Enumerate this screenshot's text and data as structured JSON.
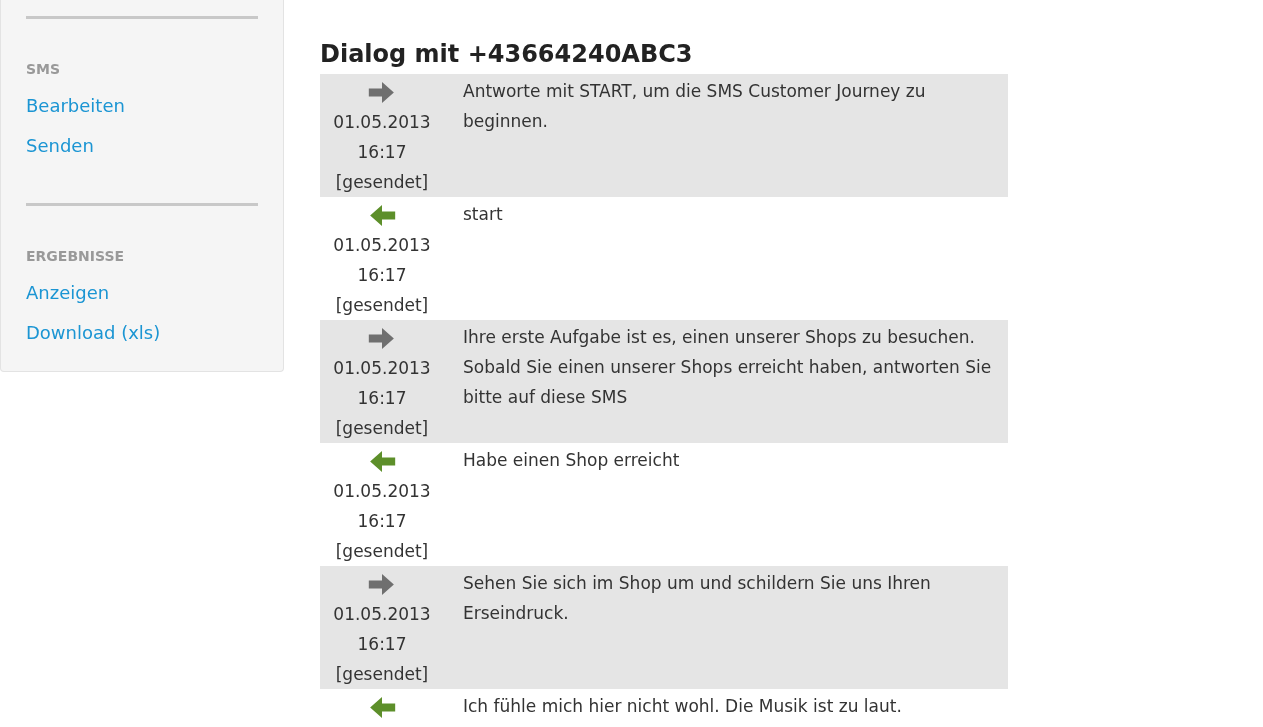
{
  "sidebar": {
    "sections": [
      {
        "header": "SMS",
        "links": [
          "Bearbeiten",
          "Senden"
        ]
      },
      {
        "header": "ERGEBNISSE",
        "links": [
          "Anzeigen",
          "Download (xls)"
        ]
      }
    ]
  },
  "dialog": {
    "title": "Dialog mit +43664240ABC3",
    "messages": [
      {
        "kind": "outgoing",
        "date": "01.05.2013",
        "time": "16:17",
        "status": "[gesendet]",
        "text": "Antworte mit START, um die SMS Customer Journey zu beginnen."
      },
      {
        "kind": "incoming",
        "date": "01.05.2013",
        "time": "16:17",
        "status": "[gesendet]",
        "text": "start"
      },
      {
        "kind": "outgoing",
        "date": "01.05.2013",
        "time": "16:17",
        "status": "[gesendet]",
        "text": "Ihre erste Aufgabe ist es, einen unserer Shops zu besuchen. Sobald Sie einen unserer Shops erreicht haben, antworten Sie bitte auf diese SMS"
      },
      {
        "kind": "incoming",
        "date": "01.05.2013",
        "time": "16:17",
        "status": "[gesendet]",
        "text": "Habe einen Shop erreicht"
      },
      {
        "kind": "outgoing",
        "date": "01.05.2013",
        "time": "16:17",
        "status": "[gesendet]",
        "text": "Sehen Sie sich im Shop um und schildern Sie uns Ihren Erseindruck."
      },
      {
        "kind": "incoming",
        "text": "Ich fühle mich hier nicht wohl. Die Musik ist zu laut."
      }
    ]
  }
}
